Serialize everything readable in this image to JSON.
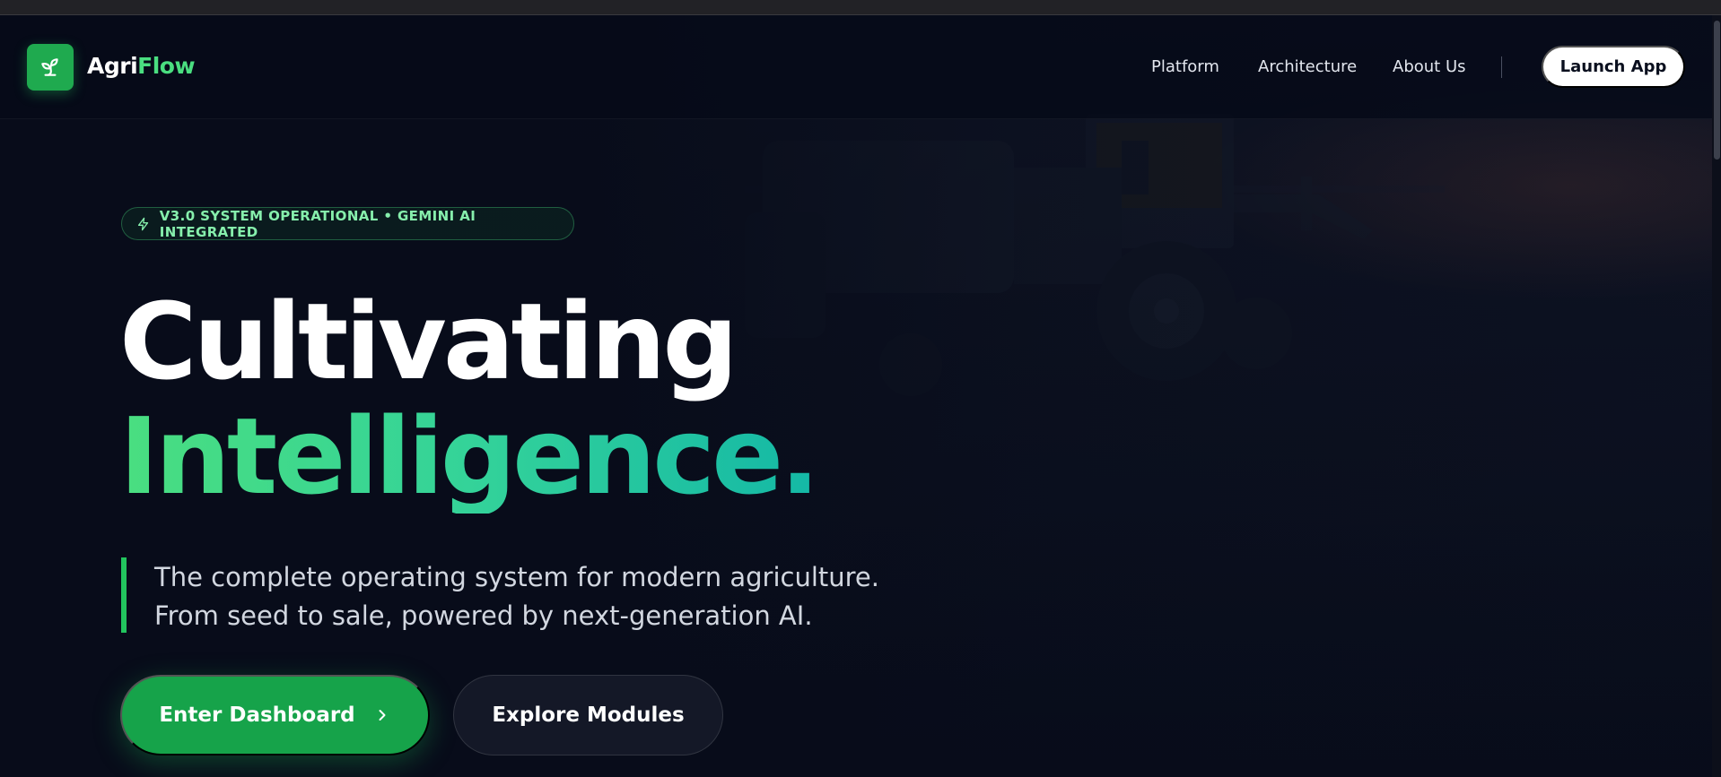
{
  "brand": {
    "name_part1": "Agri",
    "name_part2": "Flow",
    "accent_color": "#4ade80",
    "logo_icon": "sprout-icon"
  },
  "nav": {
    "links": [
      "Platform",
      "Architecture",
      "About Us"
    ],
    "cta_label": "Launch App"
  },
  "hero": {
    "status_icon": "zap-icon",
    "status_text": "V3.0 SYSTEM OPERATIONAL • GEMINI AI INTEGRATED",
    "headline_line1": "Cultivating",
    "headline_line2": "Intelligence.",
    "tagline_line1": "The complete operating system for modern agriculture.",
    "tagline_line2": "From seed to sale, powered by next-generation AI.",
    "primary_cta": "Enter Dashboard",
    "primary_cta_icon": "chevron-right-icon",
    "secondary_cta": "Explore Modules",
    "background_image": "tractor-field-at-dusk"
  },
  "colors": {
    "primary_green": "#16a34a",
    "gradient_start": "#4ade80",
    "gradient_end": "#14b8a6",
    "background": "#080d1c"
  }
}
